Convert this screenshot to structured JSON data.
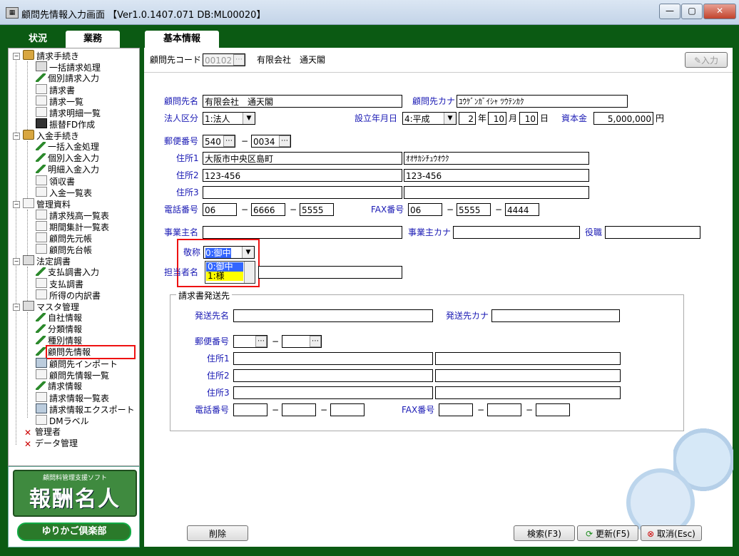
{
  "window": {
    "title": "顧問先情報入力画面 【Ver1.0.1407.071 DB:ML00020】",
    "controls": {
      "minimize": "—",
      "maximize": "▢",
      "close": "✕"
    }
  },
  "tabs": {
    "left": [
      {
        "label": "状況"
      },
      {
        "label": "業務"
      }
    ],
    "main": {
      "label": "基本情報"
    }
  },
  "tree": [
    {
      "label": "請求手続き",
      "icon": "folder-icon"
    },
    {
      "label": "一括請求処理",
      "icon": "grid-icon"
    },
    {
      "label": "個別請求入力",
      "icon": "pen-icon"
    },
    {
      "label": "請求書",
      "icon": "doc-icon"
    },
    {
      "label": "請求一覧",
      "icon": "doc-icon"
    },
    {
      "label": "請求明細一覧",
      "icon": "doc-icon"
    },
    {
      "label": "振替FD作成",
      "icon": "disk-icon"
    },
    {
      "label": "入金手続き",
      "icon": "folder-icon"
    },
    {
      "label": "一括入金処理",
      "icon": "pen-icon"
    },
    {
      "label": "個別入金入力",
      "icon": "pen-icon"
    },
    {
      "label": "明細入金入力",
      "icon": "pen-icon"
    },
    {
      "label": "領収書",
      "icon": "doc-icon"
    },
    {
      "label": "入金一覧表",
      "icon": "doc-icon"
    },
    {
      "label": "管理資料",
      "icon": "doc-icon"
    },
    {
      "label": "請求残高一覧表",
      "icon": "doc-icon"
    },
    {
      "label": "期間集計一覧表",
      "icon": "doc-icon"
    },
    {
      "label": "顧問先元帳",
      "icon": "doc-icon"
    },
    {
      "label": "顧問先台帳",
      "icon": "doc-icon"
    },
    {
      "label": "法定調書",
      "icon": "grid-icon"
    },
    {
      "label": "支払調書入力",
      "icon": "pen-icon"
    },
    {
      "label": "支払調書",
      "icon": "doc-icon"
    },
    {
      "label": "所得の内訳書",
      "icon": "doc-icon"
    },
    {
      "label": "マスタ管理",
      "icon": "grid-icon"
    },
    {
      "label": "自社情報",
      "icon": "pen-icon"
    },
    {
      "label": "分類情報",
      "icon": "pen-icon"
    },
    {
      "label": "種別情報",
      "icon": "pen-icon"
    },
    {
      "label": "顧問先情報",
      "icon": "pen-icon"
    },
    {
      "label": "顧問先インポート",
      "icon": "computer-icon"
    },
    {
      "label": "顧問先情報一覧",
      "icon": "doc-icon"
    },
    {
      "label": "請求情報",
      "icon": "pen-icon"
    },
    {
      "label": "請求情報一覧表",
      "icon": "doc-icon"
    },
    {
      "label": "請求情報エクスポート",
      "icon": "computer-icon"
    },
    {
      "label": "DMラベル",
      "icon": "doc-icon"
    },
    {
      "label": "管理者",
      "icon": "tools-icon"
    },
    {
      "label": "データ管理",
      "icon": "tools-icon"
    }
  ],
  "logo": {
    "subtitle": "顧問料管理支援ソフト",
    "main": "報酬名人",
    "bottom": "ゆりかご倶楽部"
  },
  "header": {
    "client_code_label": "顧問先コード",
    "client_code": "00102",
    "client_name": "有限会社　通天閣",
    "input_button": "入力"
  },
  "form": {
    "name_label": "顧問先名",
    "name": "有限会社　通天閣",
    "kana_label": "顧問先カナ",
    "kana": "ﾕｳｹﾞﾝｶﾞｲｼｬ ﾂｳﾃﾝｶｸ",
    "corp_type_label": "法人区分",
    "corp_type": "1:法人",
    "established_label": "設立年月日",
    "era": "4:平成",
    "year": "2",
    "year_unit": "年",
    "month": "10",
    "month_unit": "月",
    "day": "10",
    "day_unit": "日",
    "capital_label": "資本金",
    "capital": "5,000,000",
    "capital_unit": "円",
    "postal_label": "郵便番号",
    "postal1": "540",
    "postal2": "0034",
    "dash": "−",
    "addr1_label": "住所1",
    "addr1": "大阪市中央区島町",
    "addr1_kana": "ｵｵｻｶｼﾁｭｳｵｳｸ",
    "addr2_label": "住所2",
    "addr2": "123-456",
    "addr2_kana": "123-456",
    "addr3_label": "住所3",
    "phone_label": "電話番号",
    "phone1": "06",
    "phone2": "6666",
    "phone3": "5555",
    "fax_label": "FAX番号",
    "fax1": "06",
    "fax2": "5555",
    "fax3": "4444",
    "owner_label": "事業主名",
    "owner_kana_label": "事業主カナ",
    "title_label": "役職",
    "honorific_label": "敬称",
    "honorific": "0:御中",
    "honorific_options": [
      "0:御中",
      "1:様"
    ],
    "contact_label": "担当者名"
  },
  "billing": {
    "group_title": "請求書発送先",
    "name_label": "発送先名",
    "kana_label": "発送先カナ",
    "postal_label": "郵便番号",
    "addr1_label": "住所1",
    "addr2_label": "住所2",
    "addr3_label": "住所3",
    "phone_label": "電話番号",
    "fax_label": "FAX番号",
    "dash": "−"
  },
  "buttons": {
    "delete": "削除",
    "search": "検索(F3)",
    "update": "更新(F5)",
    "cancel": "取消(Esc)"
  },
  "colors": {
    "accent_green": "#0b5a13",
    "label_blue": "#1a1ab4",
    "highlight_red": "#e11111",
    "selected_yellow": "#ffff00"
  }
}
